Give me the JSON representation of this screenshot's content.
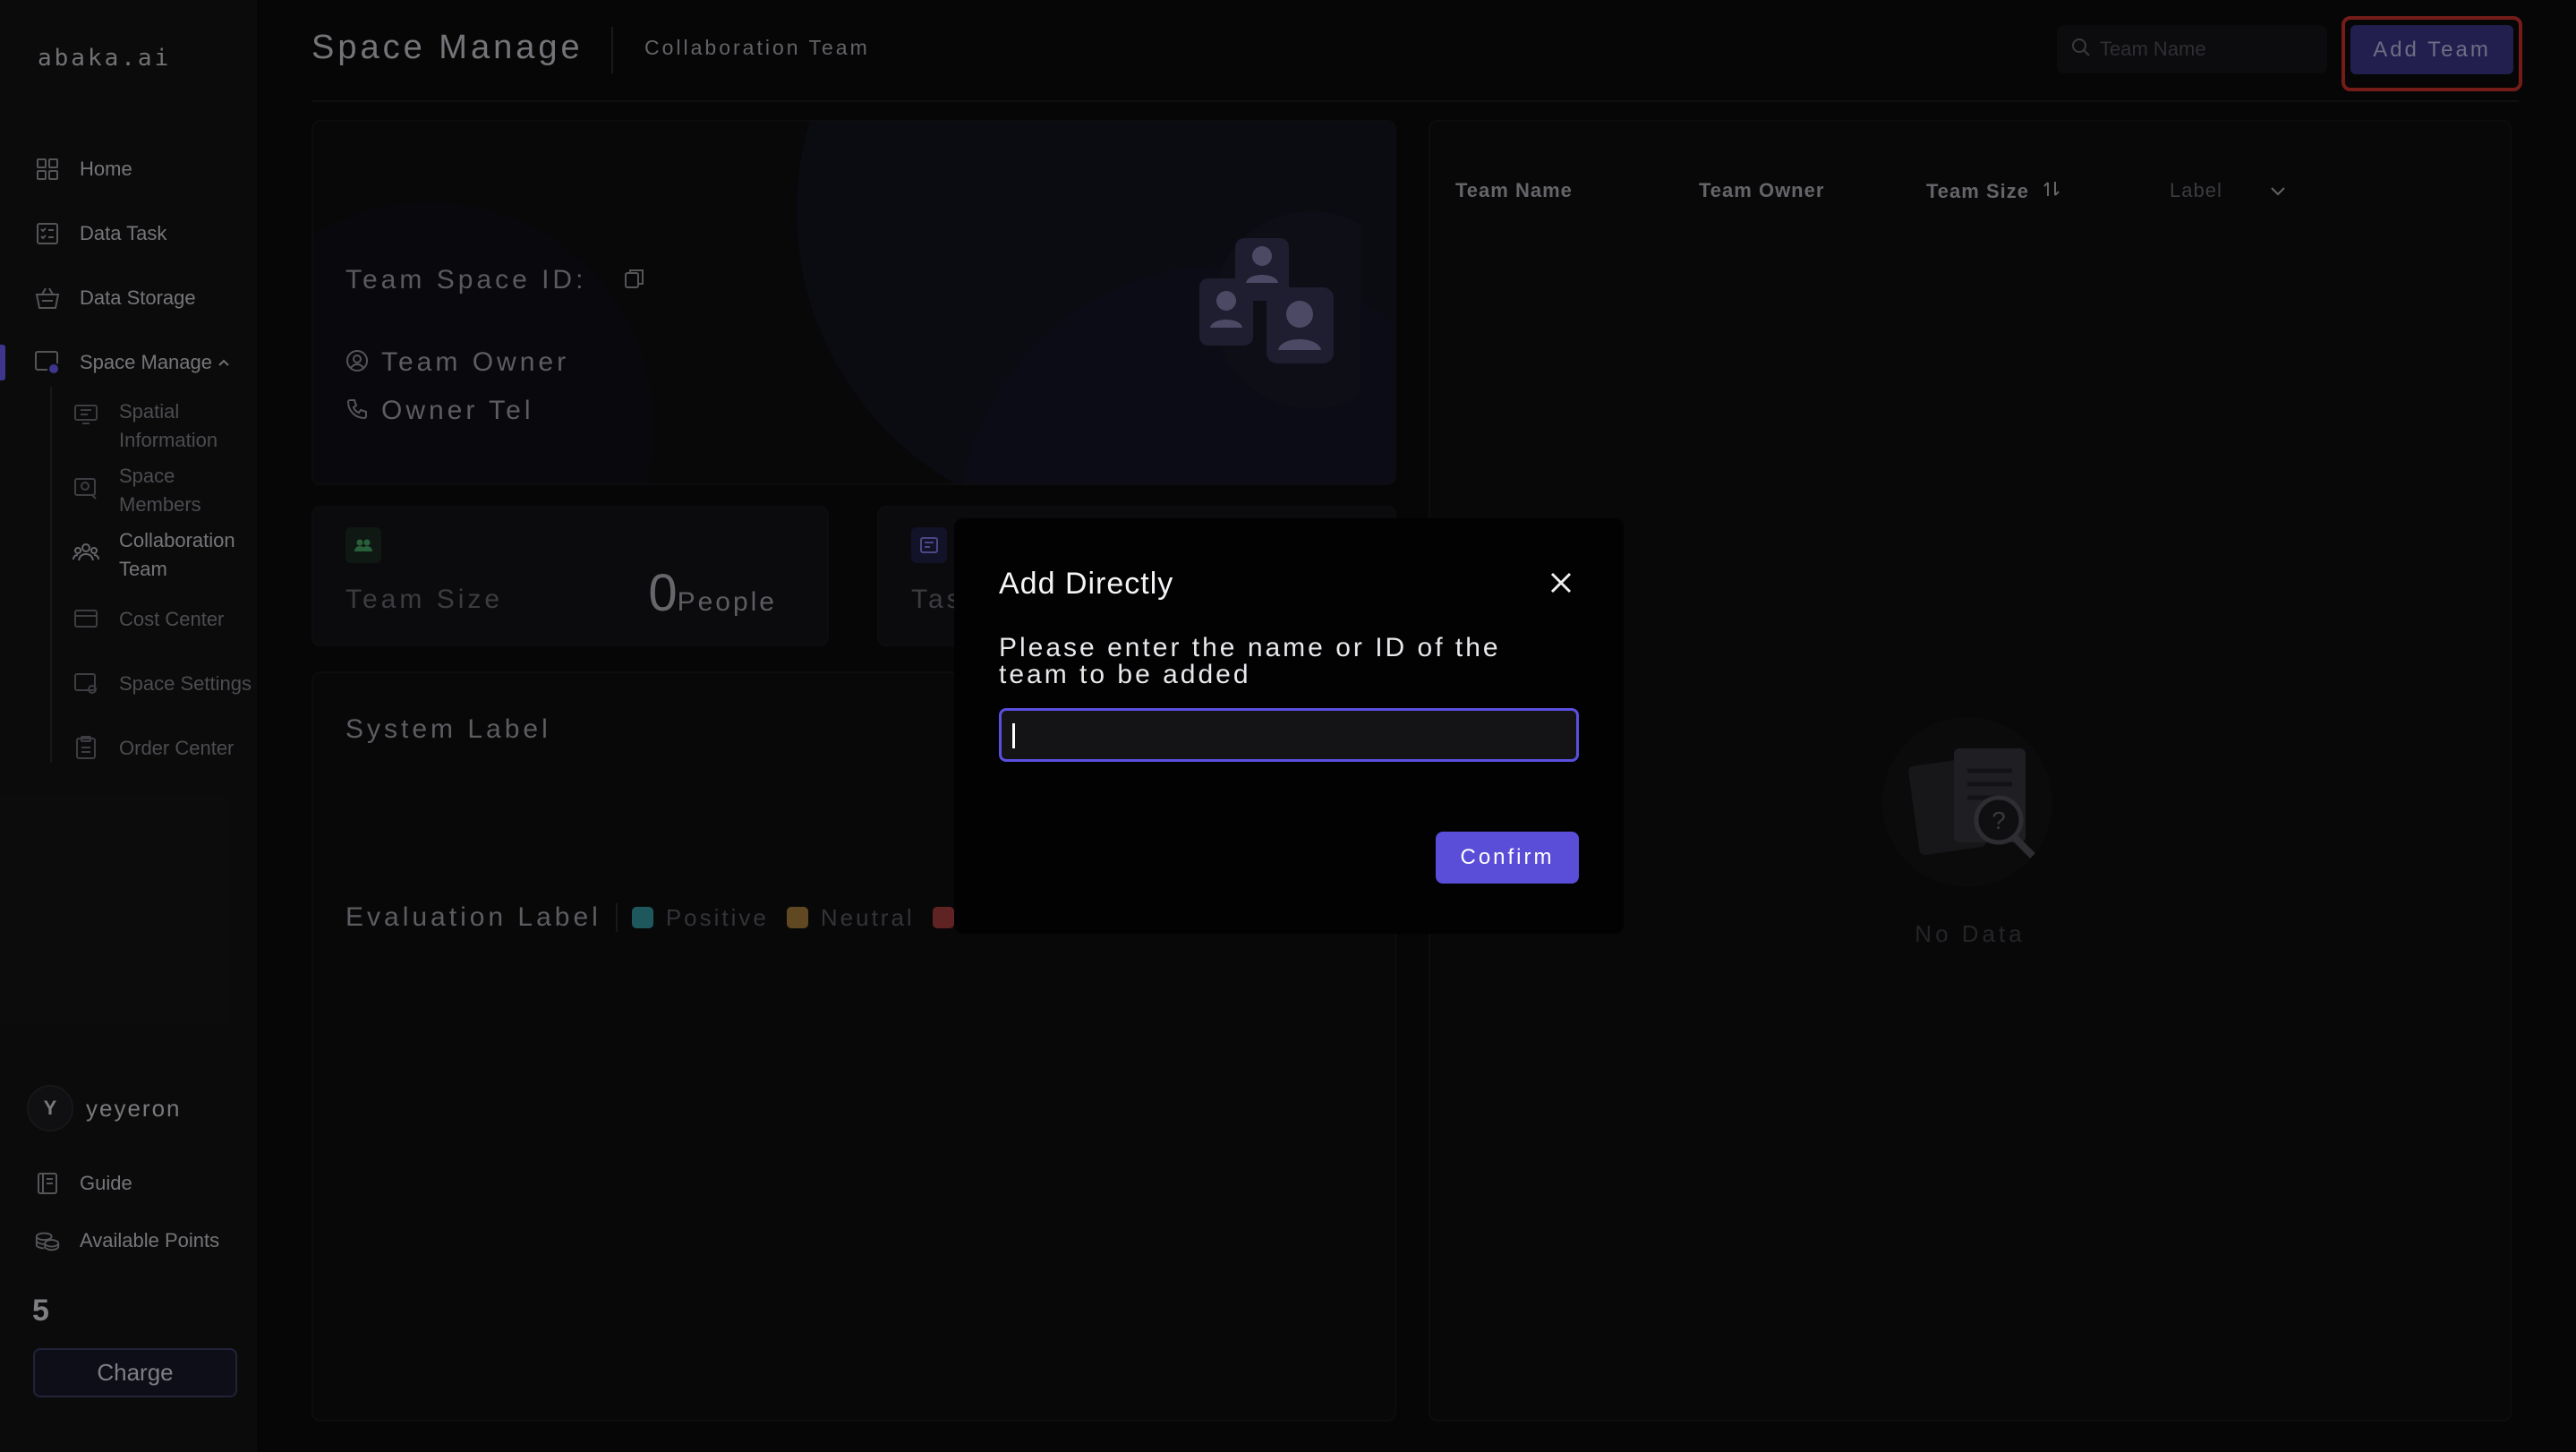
{
  "app": {
    "logo": "abaka.ai"
  },
  "sidebar": {
    "items": [
      {
        "label": "Home",
        "icon": "grid-icon"
      },
      {
        "label": "Data Task",
        "icon": "checklist-icon"
      },
      {
        "label": "Data Storage",
        "icon": "basket-icon"
      },
      {
        "label": "Space Manage",
        "icon": "space-manage-icon",
        "expanded": true
      }
    ],
    "sub_items": [
      {
        "label": "Spatial Information",
        "icon": "monitor-icon"
      },
      {
        "label": "Space Members",
        "icon": "member-icon"
      },
      {
        "label": "Collaboration Team",
        "icon": "team-icon",
        "active": true
      },
      {
        "label": "Cost Center",
        "icon": "card-icon"
      },
      {
        "label": "Space Settings",
        "icon": "settings-icon"
      },
      {
        "label": "Order Center",
        "icon": "clipboard-icon"
      }
    ],
    "user": {
      "initial": "Y",
      "name": "yeyeron"
    },
    "guide_label": "Guide",
    "points_label": "Available Points",
    "points_value": "5",
    "charge_label": "Charge"
  },
  "header": {
    "title": "Space Manage",
    "subtitle": "Collaboration Team",
    "search_placeholder": "Team Name",
    "add_team_label": "Add Team"
  },
  "info_card": {
    "team_space_id_label": "Team Space ID:",
    "team_owner_label": "Team Owner",
    "owner_tel_label": "Owner Tel"
  },
  "stats": {
    "team_size_label": "Team Size",
    "team_size_value": "0",
    "team_size_unit": "People",
    "second_label_partial": "Tas"
  },
  "labels": {
    "system_label": "System Label",
    "evaluation_label": "Evaluation Label",
    "legend": [
      {
        "label": "Positive",
        "color": "#3aa0a8"
      },
      {
        "label": "Neutral",
        "color": "#b08440"
      },
      {
        "label": "",
        "color": "#b04040"
      }
    ]
  },
  "table": {
    "columns": [
      "Team Name",
      "Team Owner",
      "Team Size",
      "Label"
    ],
    "empty_text": "No Data"
  },
  "modal": {
    "title": "Add Directly",
    "prompt": "Please enter the name or ID of the team to be added",
    "input_value": "",
    "confirm_label": "Confirm"
  },
  "colors": {
    "accent": "#5a4ed8",
    "highlight": "#d6332c",
    "background": "#0b0b0d"
  }
}
